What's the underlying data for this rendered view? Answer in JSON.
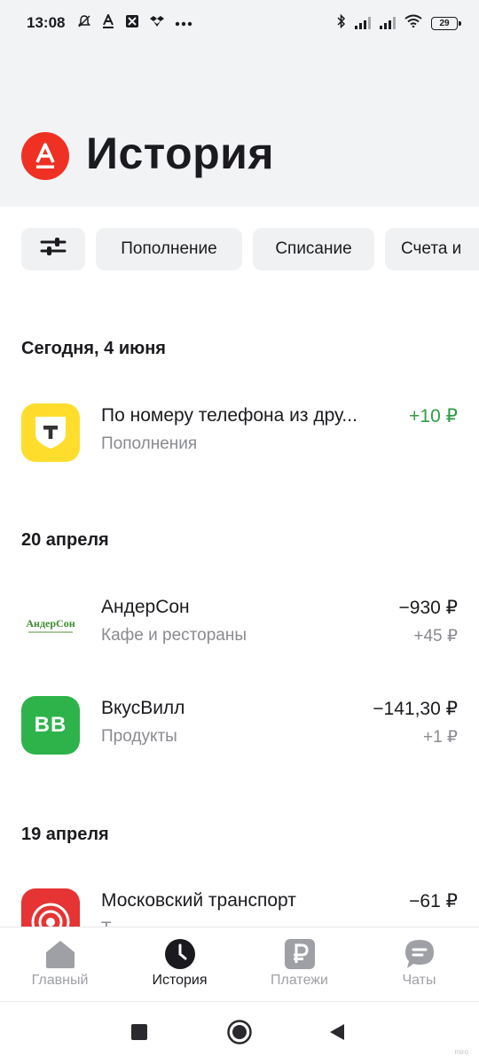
{
  "status_bar": {
    "time": "13:08",
    "left_icons": [
      "muted-bell-icon",
      "alfa-notify-icon",
      "app-notify-icon",
      "dropbox-icon",
      "more-dots-icon"
    ],
    "right_icons": [
      "bluetooth-icon",
      "signal-icon",
      "signal-icon",
      "wifi-icon",
      "battery-icon"
    ],
    "battery_level": "29"
  },
  "header": {
    "title": "История",
    "logo_letter": "А",
    "brand_color": "#ef3124"
  },
  "filters": {
    "settings_icon": "sliders-icon",
    "chips": [
      "Пополнение",
      "Списание",
      "Счета и"
    ]
  },
  "sections": [
    {
      "date": "Сегодня, 4 июня",
      "transactions": [
        {
          "title": "По номеру телефона из дру...",
          "category": "Пополнения",
          "amount": "+10 ₽",
          "amount_color": "#2e9e45",
          "icon": "t-bank-logo-icon",
          "icon_text": "Т"
        }
      ]
    },
    {
      "date": "20 апреля",
      "transactions": [
        {
          "title": "АндерСон",
          "category": "Кафе и рестораны",
          "amount": "−930 ₽",
          "cashback": "+45 ₽",
          "icon": "andersen-logo-icon",
          "icon_text": "АндерСон"
        },
        {
          "title": "ВкусВилл",
          "category": "Продукты",
          "amount": "−141,30 ₽",
          "cashback": "+1 ₽",
          "icon": "vkusvill-logo-icon",
          "icon_text": "ВВ"
        }
      ]
    },
    {
      "date": "19 апреля",
      "transactions": [
        {
          "title": "Московский транспорт",
          "category": "Т",
          "amount": "−61 ₽",
          "icon": "moscow-transport-logo-icon"
        }
      ]
    }
  ],
  "bottom_nav": {
    "items": [
      {
        "label": "Главный",
        "icon": "home-icon",
        "active": false
      },
      {
        "label": "История",
        "icon": "clock-icon",
        "active": true
      },
      {
        "label": "Платежи",
        "icon": "ruble-icon",
        "active": false
      },
      {
        "label": "Чаты",
        "icon": "chat-icon",
        "active": false
      }
    ]
  },
  "system_nav": {
    "buttons": [
      "recents-square-icon",
      "home-circle-icon",
      "back-triangle-icon"
    ]
  },
  "watermark": "miro"
}
